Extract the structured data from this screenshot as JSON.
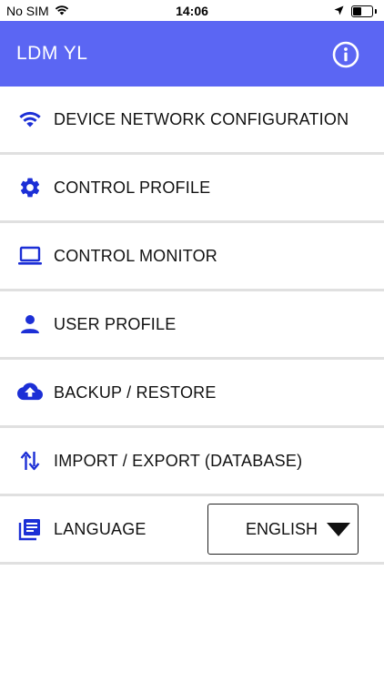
{
  "status_bar": {
    "carrier": "No SIM",
    "time": "14:06"
  },
  "app": {
    "title": "LDM YL"
  },
  "menu": {
    "items": [
      {
        "label": "DEVICE NETWORK CONFIGURATION",
        "icon": "wifi-icon"
      },
      {
        "label": "CONTROL PROFILE",
        "icon": "gear-icon"
      },
      {
        "label": "CONTROL MONITOR",
        "icon": "laptop-icon"
      },
      {
        "label": "USER PROFILE",
        "icon": "person-icon"
      },
      {
        "label": "BACKUP / RESTORE",
        "icon": "cloud-upload-icon"
      },
      {
        "label": "IMPORT / EXPORT (DATABASE)",
        "icon": "swap-vertical-icon"
      },
      {
        "label": "LANGUAGE",
        "icon": "library-books-icon"
      }
    ]
  },
  "language": {
    "selected": "ENGLISH"
  },
  "colors": {
    "accent": "#5b66f3",
    "icon": "#1c2fd6",
    "divider": "#e0e0e0"
  }
}
